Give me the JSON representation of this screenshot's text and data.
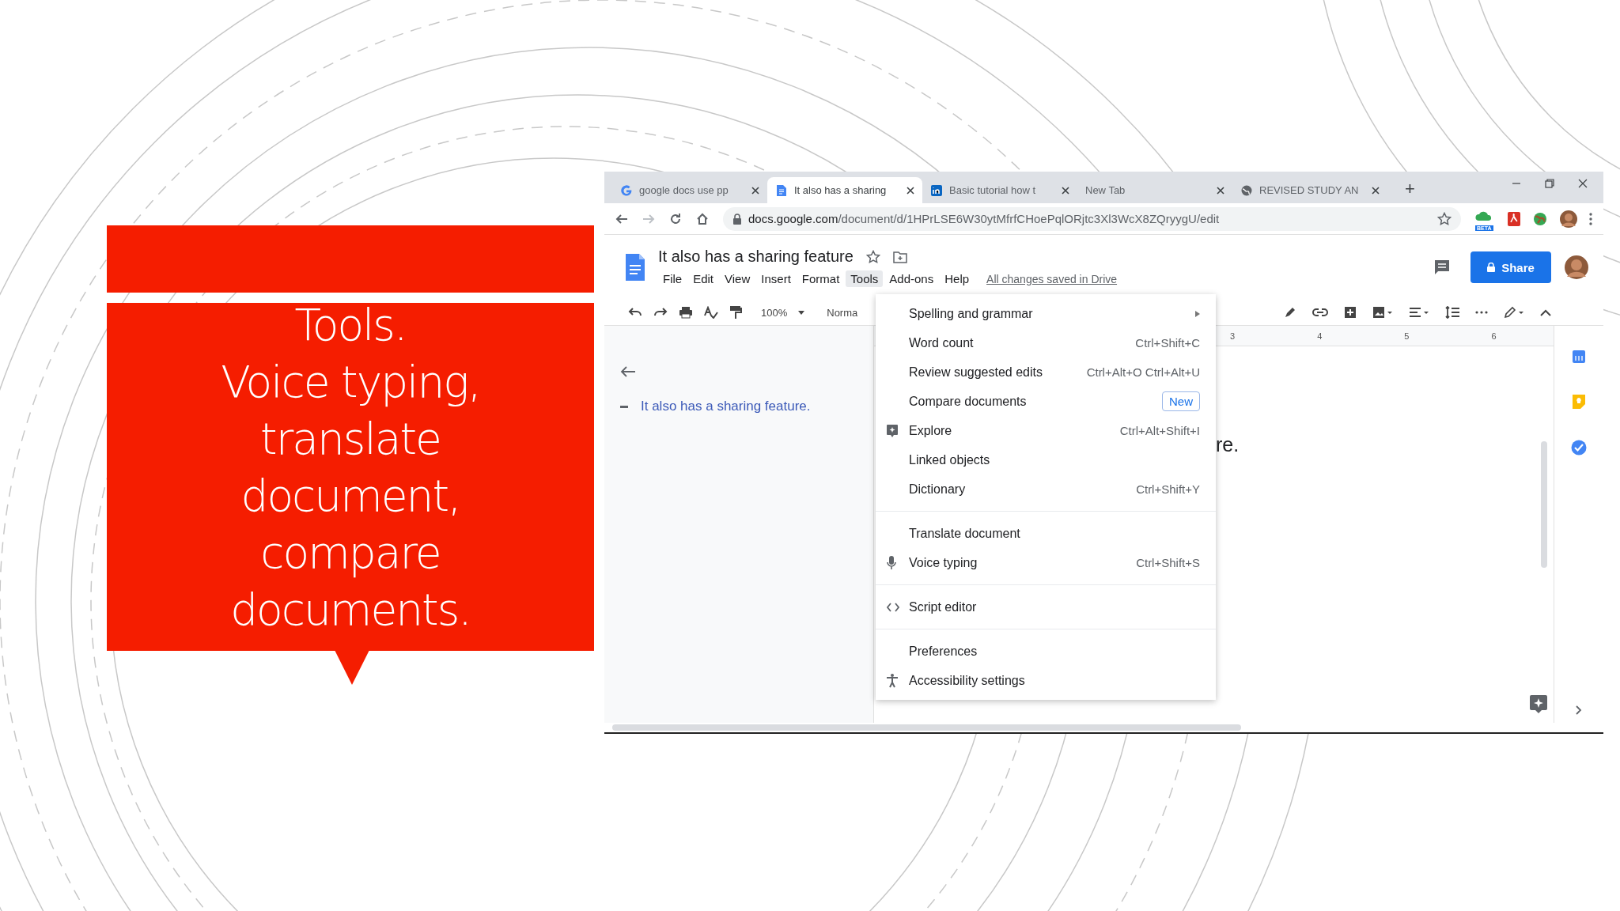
{
  "callout": {
    "text": "Tools.\nVoice typing,\ntranslate\ndocument,\ncompare\ndocuments."
  },
  "browser": {
    "tabs": [
      {
        "title": "google docs use pp",
        "kind": "google",
        "selected": false
      },
      {
        "title": "It also has a sharing",
        "kind": "docs",
        "selected": true
      },
      {
        "title": "Basic tutorial how t",
        "kind": "linkedin",
        "selected": false
      },
      {
        "title": "New Tab",
        "kind": "blank",
        "selected": false
      },
      {
        "title": "REVISED STUDY AN",
        "kind": "web",
        "selected": false
      }
    ],
    "new_tab": "+",
    "address": {
      "host": "docs.google.com",
      "path": "/document/d/1HPrLSE6W30ytMfrfCHoePqlORjtc3Xl3WcX8ZQryygU/edit"
    },
    "extension_badge": "BETA"
  },
  "docs": {
    "title": "It also has a sharing feature",
    "menus": [
      {
        "label": "File",
        "selected": false
      },
      {
        "label": "Edit",
        "selected": false
      },
      {
        "label": "View",
        "selected": false
      },
      {
        "label": "Insert",
        "selected": false
      },
      {
        "label": "Format",
        "selected": false
      },
      {
        "label": "Tools",
        "selected": true
      },
      {
        "label": "Add-ons",
        "selected": false
      },
      {
        "label": "Help",
        "selected": false
      }
    ],
    "save_status": "All changes saved in Drive",
    "share": "Share",
    "toolbar": {
      "zoom": "100%",
      "style": "Norma"
    },
    "ruler": [
      "3",
      "4",
      "5",
      "6"
    ],
    "outline_heading": "It also has a sharing feature.",
    "body_fragment": "re.",
    "tools_menu": [
      [
        {
          "label": "Spelling and grammar",
          "kind": "submenu"
        },
        {
          "label": "Word count",
          "shortcut": "Ctrl+Shift+C",
          "kind": "plain"
        },
        {
          "label": "Review suggested edits",
          "shortcut": "Ctrl+Alt+O Ctrl+Alt+U",
          "kind": "plain"
        },
        {
          "label": "Compare documents",
          "badge": "New",
          "kind": "plain"
        },
        {
          "label": "Explore",
          "shortcut": "Ctrl+Alt+Shift+I",
          "kind": "explore"
        },
        {
          "label": "Linked objects",
          "kind": "plain"
        },
        {
          "label": "Dictionary",
          "shortcut": "Ctrl+Shift+Y",
          "kind": "plain"
        }
      ],
      [
        {
          "label": "Translate document",
          "kind": "plain"
        },
        {
          "label": "Voice typing",
          "shortcut": "Ctrl+Shift+S",
          "kind": "voice"
        }
      ],
      [
        {
          "label": "Script editor",
          "kind": "script"
        }
      ],
      [
        {
          "label": "Preferences",
          "kind": "plain"
        },
        {
          "label": "Accessibility settings",
          "kind": "accessibility"
        }
      ]
    ]
  }
}
